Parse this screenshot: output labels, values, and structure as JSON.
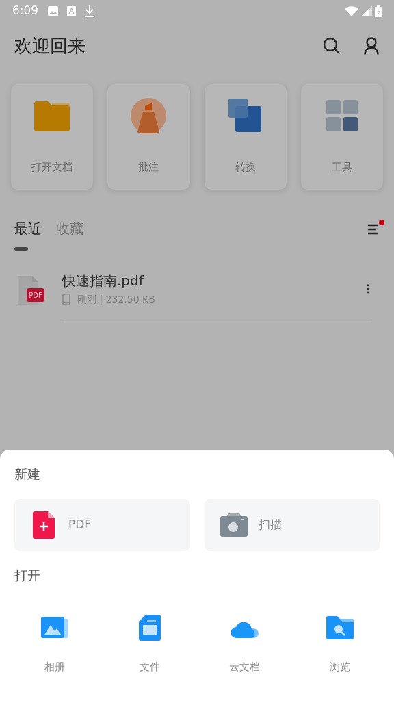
{
  "status_bar": {
    "time": "6:09"
  },
  "header": {
    "title": "欢迎回来"
  },
  "quick_actions": [
    {
      "kind": "folder",
      "label": "打开文档"
    },
    {
      "kind": "annotate",
      "label": "批注"
    },
    {
      "kind": "convert",
      "label": "转换"
    },
    {
      "kind": "tools",
      "label": "工具"
    }
  ],
  "tabs": [
    {
      "label": "最近",
      "selected": true
    },
    {
      "label": "收藏",
      "selected": false
    }
  ],
  "list_menu": {
    "has_notification": true
  },
  "files": [
    {
      "name": "快速指南.pdf",
      "badge": "PDF",
      "meta": "刚刚 | 232.50 KB"
    }
  ],
  "sheet": {
    "new_title": "新建",
    "new_items": [
      {
        "kind": "pdf",
        "label": "PDF"
      },
      {
        "kind": "scan",
        "label": "扫描"
      }
    ],
    "open_title": "打开",
    "open_items": [
      {
        "kind": "album",
        "label": "相册"
      },
      {
        "kind": "file",
        "label": "文件"
      },
      {
        "kind": "cloud",
        "label": "云文档"
      },
      {
        "kind": "browse",
        "label": "浏览"
      }
    ]
  }
}
